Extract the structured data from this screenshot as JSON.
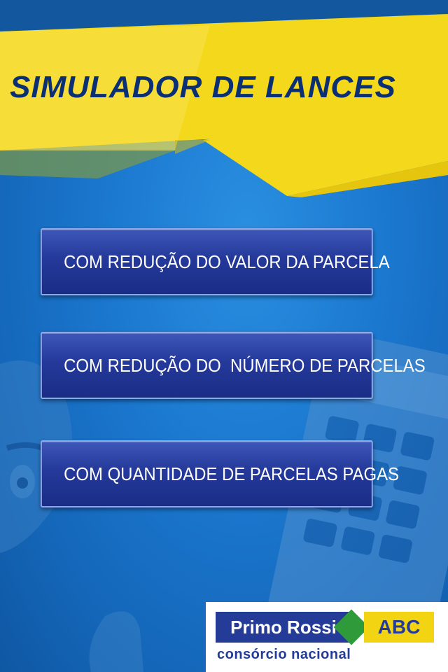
{
  "header": {
    "title": "SIMULADOR DE LANCES"
  },
  "menu": {
    "items": [
      {
        "label": "COM REDUÇÃO DO VALOR DA PARCELA"
      },
      {
        "label": "COM REDUÇÃO DO  NÚMERO DE PARCELAS"
      },
      {
        "label": "COM QUANTIDADE DE PARCELAS PAGAS"
      }
    ]
  },
  "logo": {
    "brand": "Primo Rossi",
    "badge": "ABC",
    "tagline": "consórcio nacional",
    "colors": {
      "navy": "#243b97",
      "yellow": "#f2d412",
      "green": "#2f9a3a"
    }
  },
  "colors": {
    "background": "#1b78cf",
    "banner_yellow": "#f3d81b",
    "title": "#0b2f74",
    "button": "#24399a"
  },
  "icons": [
    "mascot-figure",
    "calculator-illustration"
  ]
}
